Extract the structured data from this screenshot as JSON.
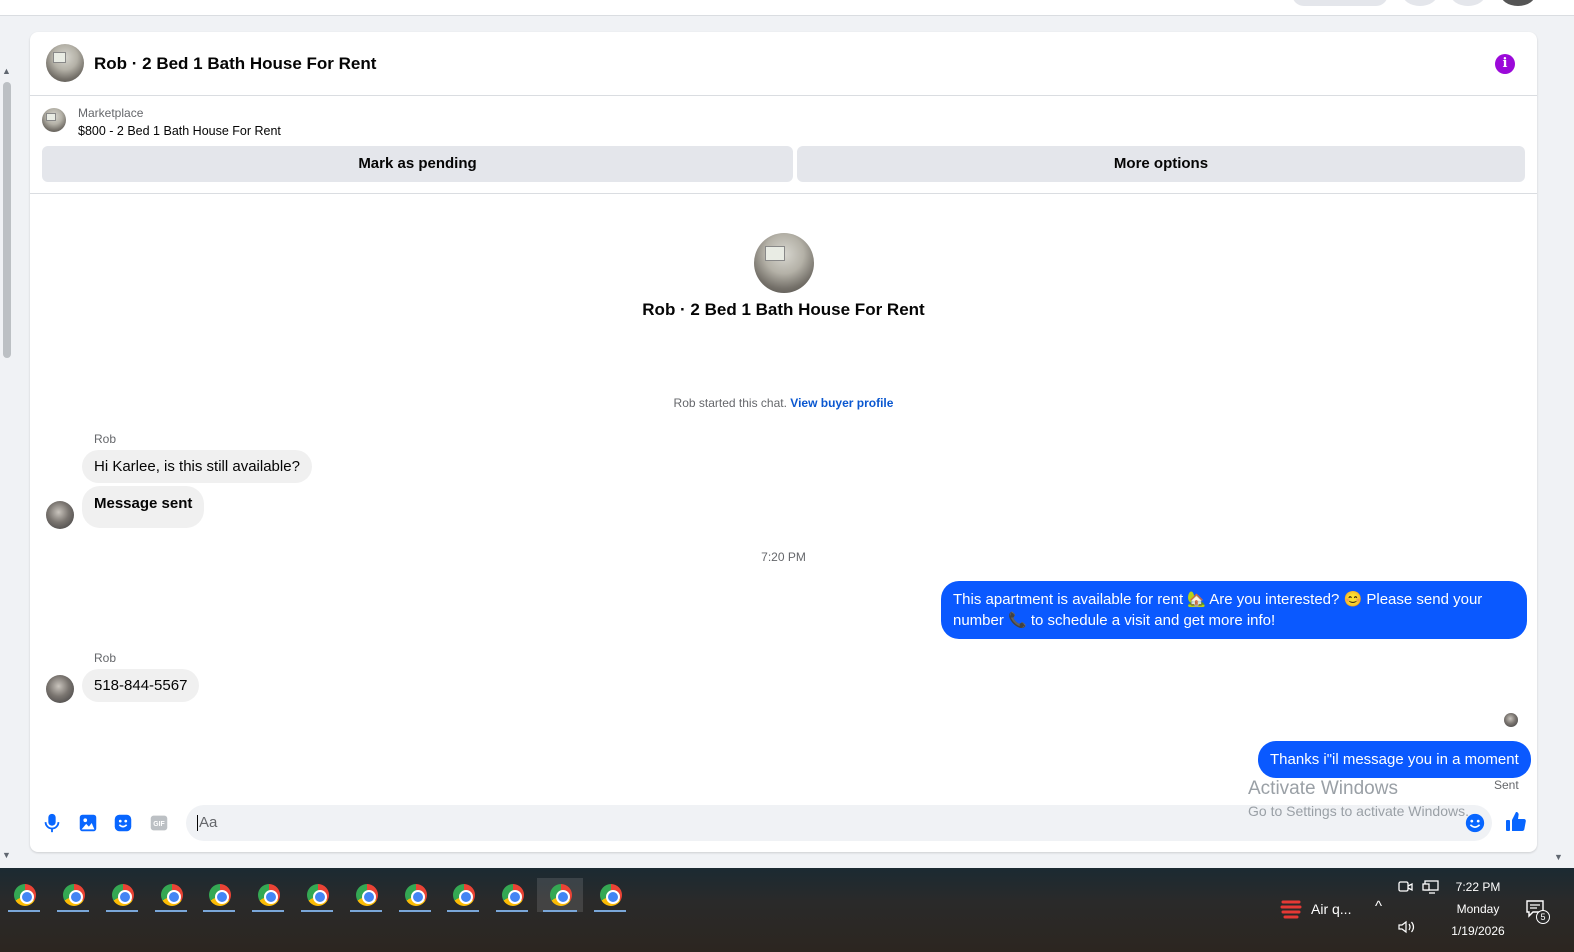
{
  "conversation": {
    "title": "Rob · 2 Bed 1 Bath House For Rent",
    "info_icon": "i"
  },
  "marketplace": {
    "label": "Marketplace",
    "listing": "$800 - 2 Bed 1 Bath House For Rent",
    "mark_pending_label": "Mark as pending",
    "more_options_label": "More options"
  },
  "intro": {
    "name": "Rob · 2 Bed 1 Bath House For Rent",
    "started_text": "Rob started this chat. ",
    "view_profile_link": "View buyer profile"
  },
  "messages": {
    "sender_1": "Rob",
    "msg_1": "Hi Karlee, is this still available?",
    "msg_2": "Message sent",
    "timestamp": "7:20 PM",
    "msg_3": "This apartment is available for rent 🏡 Are you interested? 😊 Please send your number 📞 to schedule a visit and get more info!",
    "sender_2": "Rob",
    "msg_4": "518-844-5567",
    "msg_5": "Thanks i\"il message you in a moment",
    "status": "Sent"
  },
  "composer": {
    "placeholder": "Aa"
  },
  "watermark": {
    "line1": "Activate Windows",
    "line2": "Go to Settings to activate Windows."
  },
  "taskbar": {
    "weather_label": "Air q...",
    "time": "7:22 PM",
    "day": "Monday",
    "date": "1/19/2026",
    "notification_count": "5"
  },
  "colors": {
    "accent": "#0866ff",
    "outgoing_bubble": "#0a59ff",
    "info_icon": "#9b09d9"
  }
}
